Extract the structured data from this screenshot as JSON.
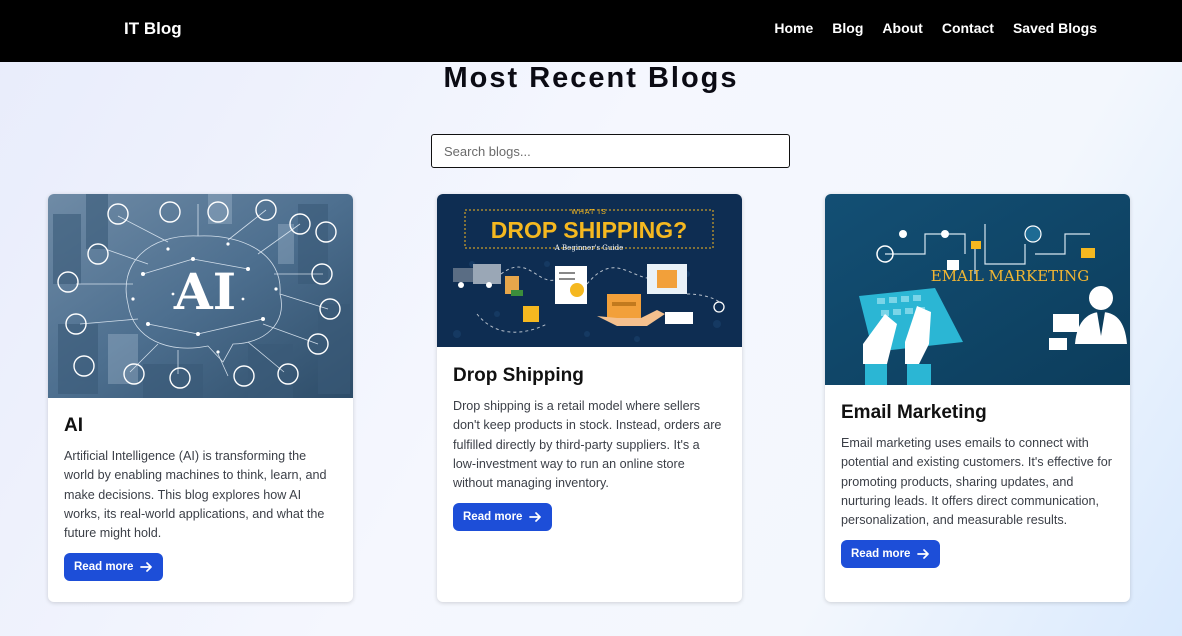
{
  "nav": {
    "brand": "IT Blog",
    "links": [
      "Home",
      "Blog",
      "About",
      "Contact",
      "Saved Blogs"
    ]
  },
  "page": {
    "title": "Most Recent Blogs"
  },
  "search": {
    "placeholder": "Search blogs..."
  },
  "posts": [
    {
      "title": "AI",
      "image_text": "AI",
      "excerpt": "Artificial Intelligence (AI) is transforming the world by enabling machines to think, learn, and make decisions. This blog explores how AI works, its real-world applications, and what the future might hold.",
      "button": "Read more"
    },
    {
      "title": "Drop Shipping",
      "image_text_small": "WHAT IS",
      "image_text": "DROP SHIPPING?",
      "image_text_sub": "A Beginner's Guide",
      "excerpt": "Drop shipping is a retail model where sellers don't keep products in stock. Instead, orders are fulfilled directly by third-party suppliers. It's a low-investment way to run an online store without managing inventory.",
      "button": "Read more"
    },
    {
      "title": "Email Marketing",
      "image_text": "EMAIL MARKETING",
      "excerpt": "Email marketing uses emails to connect with potential and existing customers. It's effective for promoting products, sharing updates, and nurturing leads. It offers direct communication, personalization, and measurable results.",
      "button": "Read more"
    }
  ],
  "colors": {
    "navbar": "#000000",
    "button": "#1d4ed8",
    "dropship_bg": "#0e2d52",
    "dropship_title": "#f5b820",
    "email_bg": "#0f4a6e",
    "email_title": "#f2b632"
  }
}
